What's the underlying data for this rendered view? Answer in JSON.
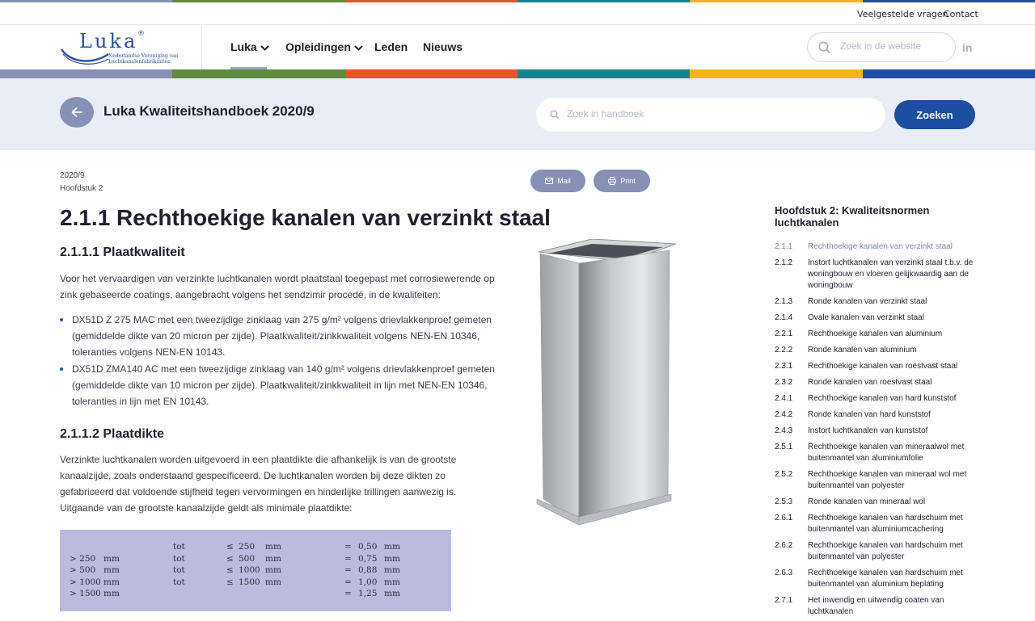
{
  "colors": {
    "stripe": [
      "#8791b6",
      "#5f8a3c",
      "#e8542a",
      "#1a8090",
      "#f2b614",
      "#1d4ea0"
    ],
    "primary": "#1d4ea0",
    "muted_button": "#8791b6",
    "table_bg": "#b9bcdf",
    "hero_bg": "#e9edf6"
  },
  "topbar": {
    "faq": "Veelgestelde vragen",
    "contact": "Contact"
  },
  "logo": {
    "word": "Luka",
    "registered": "®",
    "subtitle_line1": "Nederlandse Vereniging van",
    "subtitle_line2": "Luchtkanalenfabrikanten"
  },
  "nav": {
    "items": [
      {
        "label": "Luka",
        "has_dropdown": true,
        "active": true
      },
      {
        "label": "Opleidingen",
        "has_dropdown": true,
        "active": false
      },
      {
        "label": "Leden",
        "has_dropdown": false,
        "active": false
      },
      {
        "label": "Nieuws",
        "has_dropdown": false,
        "active": false
      }
    ],
    "search_placeholder": "Zoek in de website",
    "social_icon": "linkedin-icon",
    "social_label": "in"
  },
  "hero": {
    "title": "Luka Kwaliteitshandboek 2020/9",
    "search_placeholder": "Zoek in handboek",
    "search_button": "Zoeken"
  },
  "article": {
    "edition": "2020/9",
    "chapter": "Hoofdstuk 2",
    "mail_label": "Mail",
    "print_label": "Print",
    "title": "2.1.1 Rechthoekige kanalen van verzinkt staal",
    "section1_title": "2.1.1.1 Plaatkwaliteit",
    "section1_intro": "Voor het vervaardigen van verzinkte luchtkanalen wordt plaatstaal toegepast met corrosiewerende op zink gebaseerde coatings, aangebracht volgens het sendzimir procedé, in de kwaliteiten:",
    "bullets": [
      "DX51D Z 275 MAC met een tweezijdige zinklaag van 275 g/m² volgens drievlakkenproef gemeten (gemiddelde dikte van 20 micron per zijde). Plaatkwaliteit/zinkkwaliteit volgens NEN-EN 10346, toleranties volgens NEN-EN 10143.",
      "DX51D ZMA140 AC met een tweezijdige zinklaag van 140 g/m² volgens drievlakkenproef gemeten (gemiddelde dikte van 10 micron per zijde). Plaatkwaliteit/zinkkwaliteit in lijn met NEN-EN 10346, toleranties in lijn met EN 10143."
    ],
    "section2_title": "2.1.1.2 Plaatdikte",
    "section2_text": "Verzinkte luchtkanalen worden uitgevoerd in een plaatdikte die afhankelijk is van de grootste kanaalzijde, zoals onderstaand gespecificeerd. De luchtkanalen worden bij deze dikten zo gefabriceerd dat voldoende stijfheid tegen vervormingen en hinderlijke trillingen aanwezig is. Uitgaande van de grootste kanaalzijde geldt als minimale plaatdikte:",
    "image_alt": "Rechthoekig luchtkanaal van verzinkt staal",
    "thickness_table": [
      {
        "from": "",
        "from_unit": "",
        "tot": "tot",
        "le": "≤",
        "to": "250",
        "to_unit": "mm",
        "eq": "=",
        "value": "0,50",
        "unit": "mm"
      },
      {
        "from": "> 250",
        "from_unit": "mm",
        "tot": "tot",
        "le": "≤",
        "to": "500",
        "to_unit": "mm",
        "eq": "=",
        "value": "0,75",
        "unit": "mm"
      },
      {
        "from": "> 500",
        "from_unit": "mm",
        "tot": "tot",
        "le": "≤",
        "to": "1000",
        "to_unit": "mm",
        "eq": "=",
        "value": "0,88",
        "unit": "mm"
      },
      {
        "from": "> 1000",
        "from_unit": "mm",
        "tot": "tot",
        "le": "≤",
        "to": "1500",
        "to_unit": "mm",
        "eq": "=",
        "value": "1,00",
        "unit": "mm"
      },
      {
        "from": "> 1500",
        "from_unit": "mm",
        "tot": "",
        "le": "",
        "to": "",
        "to_unit": "",
        "eq": "=",
        "value": "1,25",
        "unit": "mm"
      }
    ]
  },
  "toc": {
    "title": "Hoofdstuk 2: Kwaliteitsnormen luchtkanalen",
    "items": [
      {
        "num": "2.1.1",
        "label": "Rechthoekige kanalen van verzinkt staal",
        "active": true
      },
      {
        "num": "2.1.2",
        "label": "Instort luchtkanalen van verzinkt staal t.b.v. de woningbouw en vloeren gelijkwaardig aan de woningbouw",
        "active": false
      },
      {
        "num": "2.1.3",
        "label": "Ronde kanalen van verzinkt staal",
        "active": false
      },
      {
        "num": "2.1.4",
        "label": "Ovale kanalen van verzinkt staal",
        "active": false
      },
      {
        "num": "2.2.1",
        "label": "Rechthoekige kanalen van aluminium",
        "active": false
      },
      {
        "num": "2.2.2",
        "label": "Ronde kanalen van aluminium",
        "active": false
      },
      {
        "num": "2.3.1",
        "label": "Rechthoekige kanalen van roestvast staal",
        "active": false
      },
      {
        "num": "2.3.2",
        "label": "Ronde kanalen van roestvast staal",
        "active": false
      },
      {
        "num": "2.4.1",
        "label": "Rechthoekige kanalen van hard kunststof",
        "active": false
      },
      {
        "num": "2.4.2",
        "label": "Ronde kanalen van hard kunststof",
        "active": false
      },
      {
        "num": "2.4.3",
        "label": "Instort luchtkanalen van kunststof",
        "active": false
      },
      {
        "num": "2.5.1",
        "label": "Rechthoekige kanalen van mineraalwol met buitenmantel van aluminiumfolie",
        "active": false
      },
      {
        "num": "2.5.2",
        "label": "Rechthoekige kanalen van mineraal wol met buitenmantel van polyester",
        "active": false
      },
      {
        "num": "2.5.3",
        "label": "Ronde kanalen van mineraal wol",
        "active": false
      },
      {
        "num": "2.6.1",
        "label": "Rechthoekige kanalen van hardschuim met buitenmantel van aluminiumcachering",
        "active": false
      },
      {
        "num": "2.6.2",
        "label": "Rechthoekige kanalen van hardschuim met buitenmantel van polyester",
        "active": false
      },
      {
        "num": "2.6.3",
        "label": "Rechthoekige kanalen van hardschuim met buitenmantel van aluminium beplating",
        "active": false
      },
      {
        "num": "2.7.1",
        "label": "Het inwendig en uitwendig coaten van luchtkanalen",
        "active": false
      }
    ]
  }
}
